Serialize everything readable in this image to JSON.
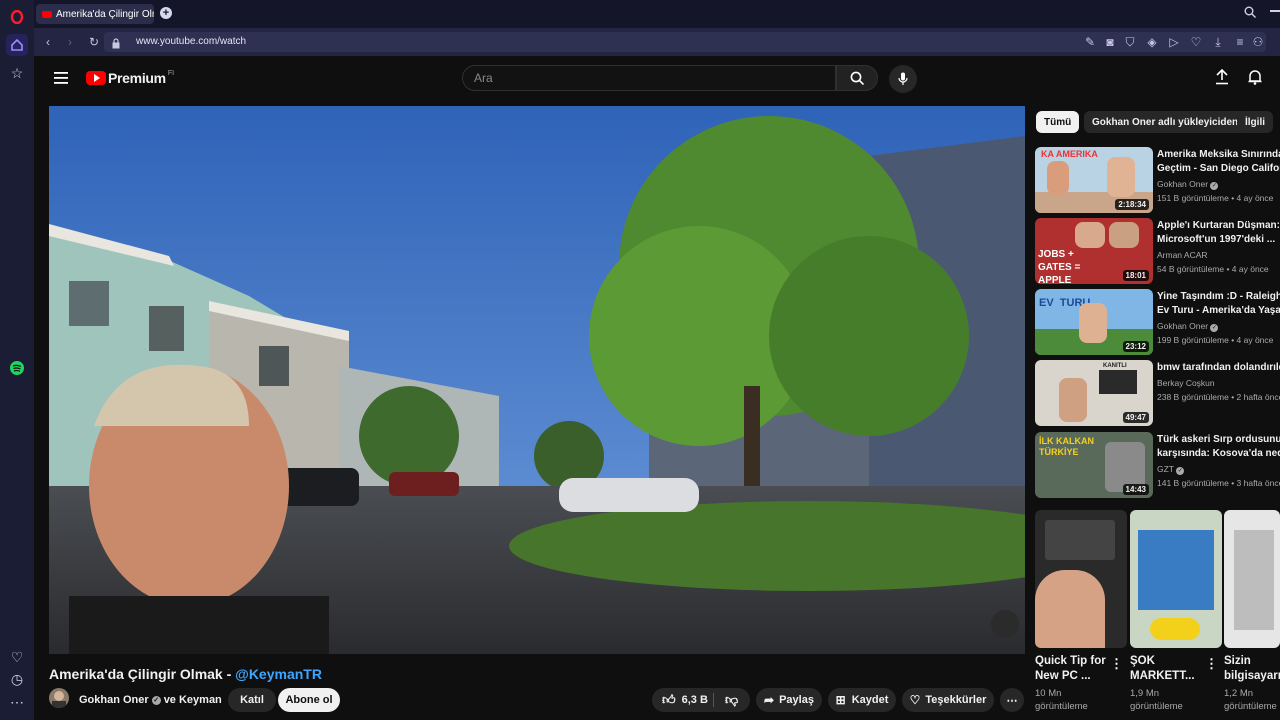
{
  "browser": {
    "tab_title": "Amerika'da Çilingir Olmak",
    "new_tab_symbol": "+",
    "url": "www.youtube.com/watch"
  },
  "youtube": {
    "logo_text": "Premium",
    "logo_superscript": "FI",
    "search_placeholder": "Ara"
  },
  "video": {
    "title": "Amerika'da Çilingir Olmak - ",
    "title_mention": "@KeymanTR",
    "channel": "Gokhan Oner",
    "channel_and": "ve Keyman",
    "join_label": "Katıl",
    "subscribe_label": "Abone ol",
    "likes": "6,3 B",
    "share_label": "Paylaş",
    "save_label": "Kaydet",
    "thanks_label": "Teşekkürler"
  },
  "chips": [
    "Tümü",
    "Gokhan Oner adlı yükleyiciden",
    "İlgili"
  ],
  "recommendations": [
    {
      "title1": "Amerika Meksika Sınırından",
      "title2": "Geçtim - San Diego Californ",
      "channel": "Gokhan Oner",
      "verified": true,
      "stats": "151 B görüntüleme • 4 ay önce",
      "duration": "2:18:34",
      "thumb_text": "KA  AMERIKA"
    },
    {
      "title1": "Apple'ı Kurtaran Düşman:",
      "title2": "Microsoft'un 1997'deki ...",
      "channel": "Arman ACAR",
      "verified": false,
      "stats": "54 B görüntüleme • 4 ay önce",
      "duration": "18:01",
      "thumb_text": "JOBS + GATES = APPLE"
    },
    {
      "title1": "Yine Taşındım :D - Raleigh N",
      "title2": "Ev Turu - Amerika'da Yaşam",
      "channel": "Gokhan Oner",
      "verified": true,
      "stats": "199 B görüntüleme • 4 ay önce",
      "duration": "23:12",
      "thumb_text": "EV  TURU"
    },
    {
      "title1": "bmw tarafından dolandırıldı",
      "title2": "",
      "channel": "Berkay Coşkun",
      "verified": false,
      "stats": "238 B görüntüleme • 2 hafta önce",
      "duration": "49:47",
      "thumb_text": "KANITLI"
    },
    {
      "title1": "Türk askeri Sırp ordusunun",
      "title2": "karşısında: Kosova'da neder",
      "channel": "GZT",
      "verified": true,
      "stats": "141 B görüntüleme • 3 hafta önce",
      "duration": "14:43",
      "thumb_text": "İLK KALKAN TÜRKİYE"
    }
  ],
  "shorts": [
    {
      "title1": "Quick Tip for",
      "title2": "New PC ...",
      "views1": "10 Mn",
      "views2": "görüntüleme"
    },
    {
      "title1": "ŞOK",
      "title2": "MARKETT...",
      "views1": "1,9 Mn",
      "views2": "görüntüleme"
    },
    {
      "title1": "Sizin",
      "title2": "bilgisayarın",
      "views1": "1,2 Mn",
      "views2": "görüntüleme"
    }
  ]
}
